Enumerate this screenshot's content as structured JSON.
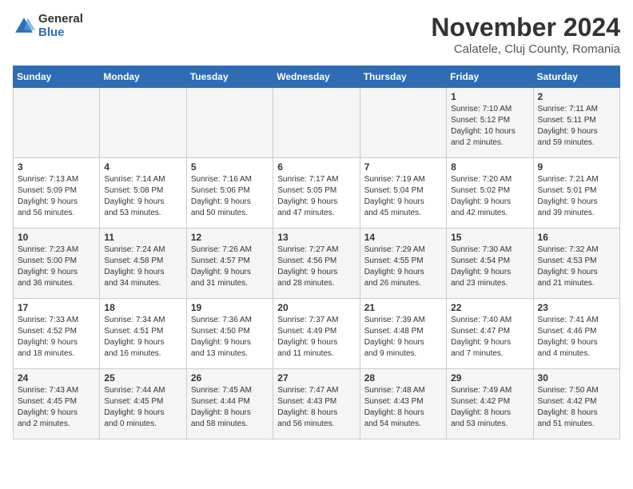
{
  "logo": {
    "general": "General",
    "blue": "Blue"
  },
  "title": "November 2024",
  "subtitle": "Calatele, Cluj County, Romania",
  "days_header": [
    "Sunday",
    "Monday",
    "Tuesday",
    "Wednesday",
    "Thursday",
    "Friday",
    "Saturday"
  ],
  "weeks": [
    [
      {
        "day": "",
        "info": ""
      },
      {
        "day": "",
        "info": ""
      },
      {
        "day": "",
        "info": ""
      },
      {
        "day": "",
        "info": ""
      },
      {
        "day": "",
        "info": ""
      },
      {
        "day": "1",
        "info": "Sunrise: 7:10 AM\nSunset: 5:12 PM\nDaylight: 10 hours\nand 2 minutes."
      },
      {
        "day": "2",
        "info": "Sunrise: 7:11 AM\nSunset: 5:11 PM\nDaylight: 9 hours\nand 59 minutes."
      }
    ],
    [
      {
        "day": "3",
        "info": "Sunrise: 7:13 AM\nSunset: 5:09 PM\nDaylight: 9 hours\nand 56 minutes."
      },
      {
        "day": "4",
        "info": "Sunrise: 7:14 AM\nSunset: 5:08 PM\nDaylight: 9 hours\nand 53 minutes."
      },
      {
        "day": "5",
        "info": "Sunrise: 7:16 AM\nSunset: 5:06 PM\nDaylight: 9 hours\nand 50 minutes."
      },
      {
        "day": "6",
        "info": "Sunrise: 7:17 AM\nSunset: 5:05 PM\nDaylight: 9 hours\nand 47 minutes."
      },
      {
        "day": "7",
        "info": "Sunrise: 7:19 AM\nSunset: 5:04 PM\nDaylight: 9 hours\nand 45 minutes."
      },
      {
        "day": "8",
        "info": "Sunrise: 7:20 AM\nSunset: 5:02 PM\nDaylight: 9 hours\nand 42 minutes."
      },
      {
        "day": "9",
        "info": "Sunrise: 7:21 AM\nSunset: 5:01 PM\nDaylight: 9 hours\nand 39 minutes."
      }
    ],
    [
      {
        "day": "10",
        "info": "Sunrise: 7:23 AM\nSunset: 5:00 PM\nDaylight: 9 hours\nand 36 minutes."
      },
      {
        "day": "11",
        "info": "Sunrise: 7:24 AM\nSunset: 4:58 PM\nDaylight: 9 hours\nand 34 minutes."
      },
      {
        "day": "12",
        "info": "Sunrise: 7:26 AM\nSunset: 4:57 PM\nDaylight: 9 hours\nand 31 minutes."
      },
      {
        "day": "13",
        "info": "Sunrise: 7:27 AM\nSunset: 4:56 PM\nDaylight: 9 hours\nand 28 minutes."
      },
      {
        "day": "14",
        "info": "Sunrise: 7:29 AM\nSunset: 4:55 PM\nDaylight: 9 hours\nand 26 minutes."
      },
      {
        "day": "15",
        "info": "Sunrise: 7:30 AM\nSunset: 4:54 PM\nDaylight: 9 hours\nand 23 minutes."
      },
      {
        "day": "16",
        "info": "Sunrise: 7:32 AM\nSunset: 4:53 PM\nDaylight: 9 hours\nand 21 minutes."
      }
    ],
    [
      {
        "day": "17",
        "info": "Sunrise: 7:33 AM\nSunset: 4:52 PM\nDaylight: 9 hours\nand 18 minutes."
      },
      {
        "day": "18",
        "info": "Sunrise: 7:34 AM\nSunset: 4:51 PM\nDaylight: 9 hours\nand 16 minutes."
      },
      {
        "day": "19",
        "info": "Sunrise: 7:36 AM\nSunset: 4:50 PM\nDaylight: 9 hours\nand 13 minutes."
      },
      {
        "day": "20",
        "info": "Sunrise: 7:37 AM\nSunset: 4:49 PM\nDaylight: 9 hours\nand 11 minutes."
      },
      {
        "day": "21",
        "info": "Sunrise: 7:39 AM\nSunset: 4:48 PM\nDaylight: 9 hours\nand 9 minutes."
      },
      {
        "day": "22",
        "info": "Sunrise: 7:40 AM\nSunset: 4:47 PM\nDaylight: 9 hours\nand 7 minutes."
      },
      {
        "day": "23",
        "info": "Sunrise: 7:41 AM\nSunset: 4:46 PM\nDaylight: 9 hours\nand 4 minutes."
      }
    ],
    [
      {
        "day": "24",
        "info": "Sunrise: 7:43 AM\nSunset: 4:45 PM\nDaylight: 9 hours\nand 2 minutes."
      },
      {
        "day": "25",
        "info": "Sunrise: 7:44 AM\nSunset: 4:45 PM\nDaylight: 9 hours\nand 0 minutes."
      },
      {
        "day": "26",
        "info": "Sunrise: 7:45 AM\nSunset: 4:44 PM\nDaylight: 8 hours\nand 58 minutes."
      },
      {
        "day": "27",
        "info": "Sunrise: 7:47 AM\nSunset: 4:43 PM\nDaylight: 8 hours\nand 56 minutes."
      },
      {
        "day": "28",
        "info": "Sunrise: 7:48 AM\nSunset: 4:43 PM\nDaylight: 8 hours\nand 54 minutes."
      },
      {
        "day": "29",
        "info": "Sunrise: 7:49 AM\nSunset: 4:42 PM\nDaylight: 8 hours\nand 53 minutes."
      },
      {
        "day": "30",
        "info": "Sunrise: 7:50 AM\nSunset: 4:42 PM\nDaylight: 8 hours\nand 51 minutes."
      }
    ]
  ]
}
